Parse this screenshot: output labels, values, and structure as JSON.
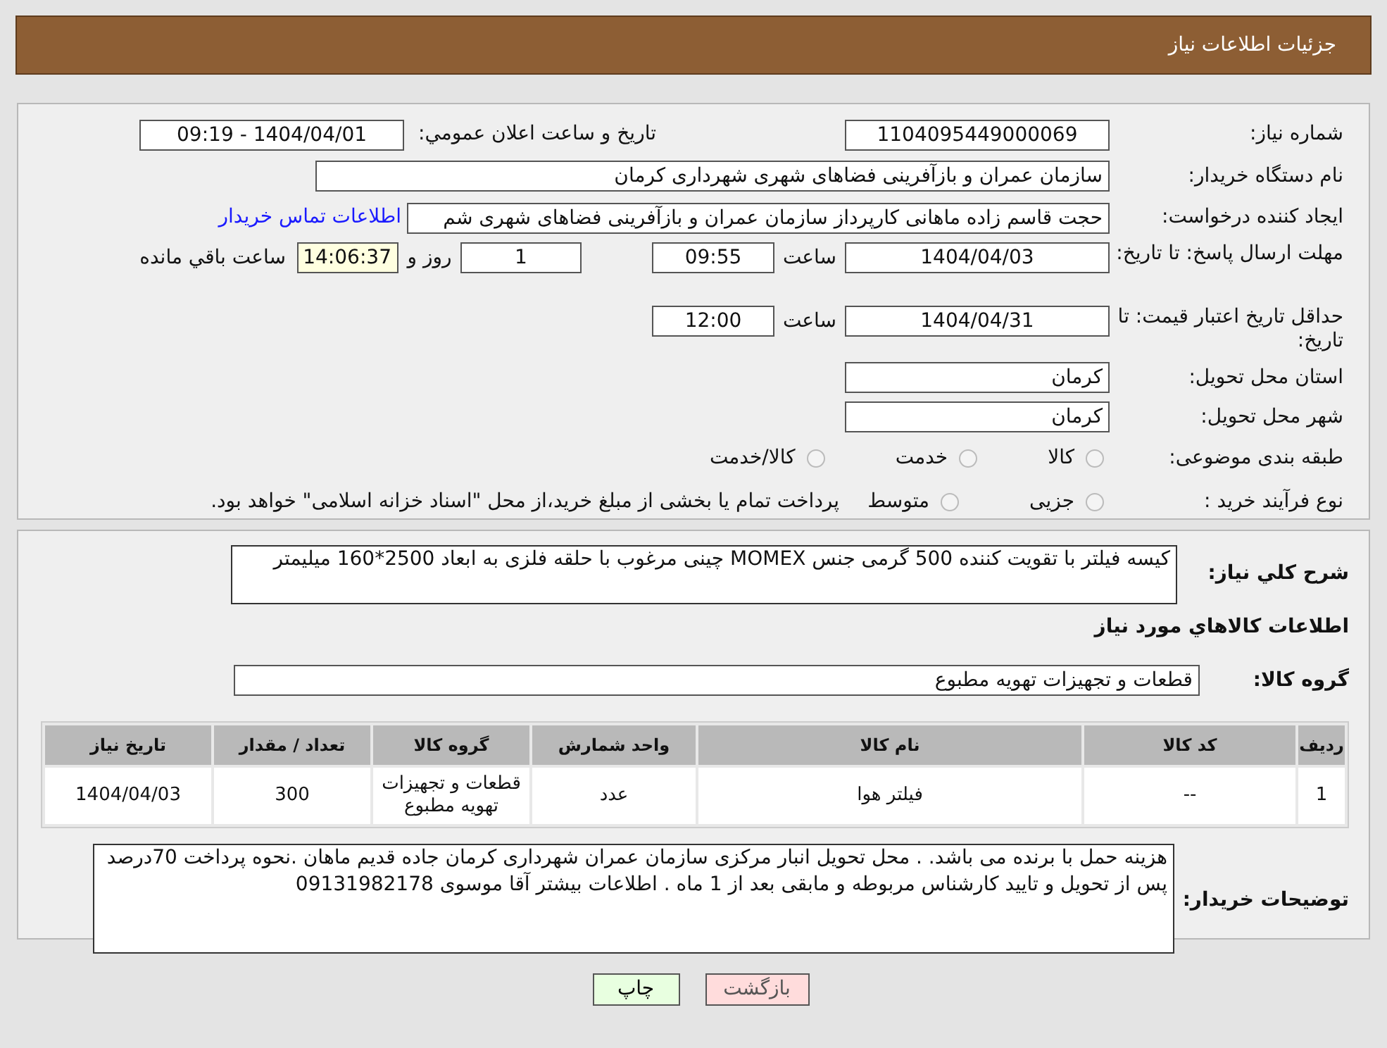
{
  "header": {
    "title": "جزئیات اطلاعات نیاز"
  },
  "need_number": {
    "label": "شماره نیاز:",
    "value": "1104095449000069"
  },
  "announce": {
    "label": "تاریخ و ساعت اعلان عمومي:",
    "value": "1404/04/01 - 09:19"
  },
  "buyer": {
    "label": "نام دستگاه خریدار:",
    "value": "سازمان عمران و بازآفرینی فضاهای شهری شهرداری کرمان"
  },
  "creator": {
    "label": "ایجاد کننده درخواست:",
    "value": "حجت قاسم زاده ماهانی کارپرداز سازمان عمران و بازآفرینی فضاهای شهری شم",
    "link": "اطلاعات تماس خریدار"
  },
  "deadline": {
    "label": "مهلت ارسال پاسخ: تا تاریخ:",
    "date": "1404/04/03",
    "time_label": "ساعت",
    "time": "09:55",
    "days": "1",
    "days_label": "روز و",
    "remaining": "14:06:37",
    "remaining_label": "ساعت باقي مانده"
  },
  "validity": {
    "label": "حداقل تاریخ اعتبار قیمت: تا تاریخ:",
    "date": "1404/04/31",
    "time_label": "ساعت",
    "time": "12:00"
  },
  "province": {
    "label": "استان محل تحویل:",
    "value": "کرمان"
  },
  "city": {
    "label": "شهر محل تحویل:",
    "value": "کرمان"
  },
  "category": {
    "label": "طبقه بندی موضوعی:",
    "options": [
      {
        "label": "کالا",
        "selected": false
      },
      {
        "label": "خدمت",
        "selected": false
      },
      {
        "label": "کالا/خدمت",
        "selected": false
      }
    ]
  },
  "process": {
    "label": "نوع فرآیند خرید :",
    "options": [
      {
        "label": "جزیی",
        "selected": false
      },
      {
        "label": "متوسط",
        "selected": false
      }
    ],
    "note": "پرداخت تمام یا بخشی از مبلغ خرید،از محل \"اسناد خزانه اسلامی\" خواهد بود."
  },
  "description": {
    "label": "شرح کلي نیاز:",
    "value": "کیسه فیلتر با تقویت کننده 500 گرمی جنس MOMEX  چینی مرغوب با حلقه فلزی به ابعاد 2500*160 میلیمتر"
  },
  "items_heading": "اطلاعات كالاهاي مورد نیاز",
  "goods_group": {
    "label": "گروه کالا:",
    "value": "قطعات و تجهیزات تهویه مطبوع"
  },
  "table": {
    "columns": [
      "ردیف",
      "کد کالا",
      "نام کالا",
      "واحد شمارش",
      "گروه کالا",
      "تعداد / مقدار",
      "تاریخ نیاز"
    ],
    "rows": [
      [
        "1",
        "--",
        "فیلتر هوا",
        "عدد",
        "قطعات و تجهیزات تهویه مطبوع",
        "300",
        "1404/04/03"
      ]
    ]
  },
  "buyer_notes": {
    "label": "توضیحات خریدار:",
    "value": "هزینه حمل با برنده می باشد. . محل تحویل انبار مرکزی سازمان عمران شهرداری کرمان جاده قدیم ماهان .نحوه پرداخت 70درصد پس از تحویل و تایید کارشناس مربوطه و مابقی بعد از 1 ماه . اطلاعات بیشتر آقا موسوی 09131982178"
  },
  "buttons": [
    {
      "kind": "back",
      "label": "بازگشت"
    },
    {
      "kind": "print",
      "label": "چاپ"
    }
  ]
}
